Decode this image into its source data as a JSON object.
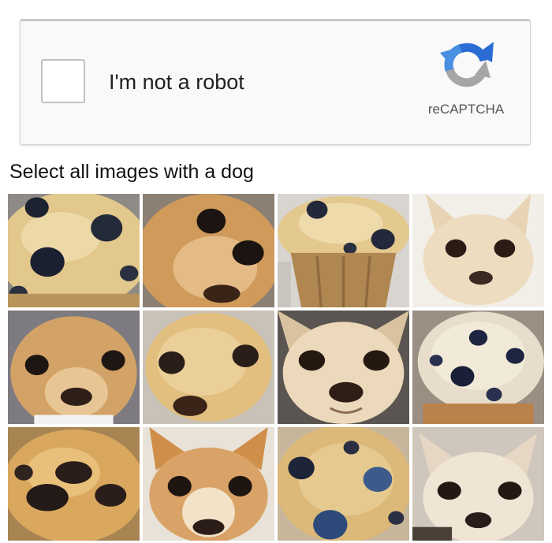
{
  "recaptcha": {
    "checkbox_label": "I'm not a robot",
    "brand": "reCAPTCHA",
    "logo_icon": "recaptcha-logo-icon",
    "colors": {
      "logo_blue": "#2b6cd4",
      "logo_light_blue": "#4a90e2",
      "logo_gray": "#a6a6a6"
    }
  },
  "challenge": {
    "instruction": "Select all images with a dog"
  },
  "grid": {
    "rows": 3,
    "columns": 4,
    "tiles": [
      {
        "subject": "muffin",
        "icon": "blueberry-muffin-icon"
      },
      {
        "subject": "dog",
        "icon": "chihuahua-icon"
      },
      {
        "subject": "muffin",
        "icon": "blueberry-muffin-icon"
      },
      {
        "subject": "dog",
        "icon": "chihuahua-icon"
      },
      {
        "subject": "dog",
        "icon": "chihuahua-icon"
      },
      {
        "subject": "muffin",
        "icon": "blueberry-muffin-icon"
      },
      {
        "subject": "dog",
        "icon": "chihuahua-icon"
      },
      {
        "subject": "muffin",
        "icon": "blueberry-muffin-icon"
      },
      {
        "subject": "muffin",
        "icon": "blueberry-muffin-icon"
      },
      {
        "subject": "dog",
        "icon": "chihuahua-icon"
      },
      {
        "subject": "muffin",
        "icon": "blueberry-muffin-icon"
      },
      {
        "subject": "dog",
        "icon": "chihuahua-icon"
      }
    ]
  }
}
